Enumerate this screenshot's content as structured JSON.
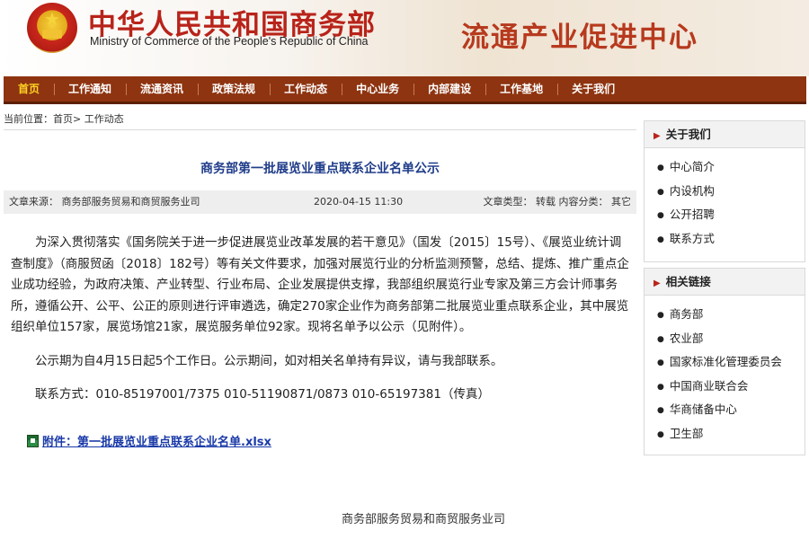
{
  "header": {
    "ministry_cn": "中华人民共和国商务部",
    "ministry_en": "Ministry of Commerce of the People's Republic of China",
    "center_name": "流通产业促进中心",
    "emblem_icon": "national-emblem-icon"
  },
  "nav": {
    "items": [
      {
        "label": "首页"
      },
      {
        "label": "工作通知"
      },
      {
        "label": "流通资讯"
      },
      {
        "label": "政策法规"
      },
      {
        "label": "工作动态"
      },
      {
        "label": "中心业务"
      },
      {
        "label": "内部建设"
      },
      {
        "label": "工作基地"
      },
      {
        "label": "关于我们"
      }
    ],
    "active_index": 0
  },
  "breadcrumb": {
    "prefix": "当前位置：",
    "home": "首页",
    "separator": ">",
    "current": "工作动态"
  },
  "article": {
    "title": "商务部第一批展览业重点联系企业名单公示",
    "source": "文章来源：   商务部服务贸易和商贸服务业司",
    "date": "2020-04-15 11:30",
    "type": "文章类型：  转载  内容分类：  其它",
    "paragraphs": [
      "为深入贯彻落实《国务院关于进一步促进展览业改革发展的若干意见》（国发〔2015〕15号）、《展览业统计调查制度》（商服贸函〔2018〕182号）等有关文件要求，加强对展览行业的分析监测预警，总结、提炼、推广重点企业成功经验，为政府决策、产业转型、行业布局、企业发展提供支撑，我部组织展览行业专家及第三方会计师事务所，遵循公开、公平、公正的原则进行评审遴选，确定270家企业作为商务部第二批展览业重点联系企业，其中展览组织单位157家，展览场馆21家，展览服务单位92家。现将名单予以公示（见附件）。",
      "公示期为自4月15日起5个工作日。公示期间，如对相关名单持有异议，请与我部联系。",
      "联系方式：010-85197001/7375  010-51190871/0873  010-65197381（传真）"
    ],
    "attachment": "附件：第一批展览业重点联系企业名单.xlsx",
    "attachment_icon": "excel-file-icon",
    "footer": "商务部服务贸易和商贸服务业司"
  },
  "sidebar": {
    "about": {
      "title": "关于我们",
      "items": [
        "中心简介",
        "内设机构",
        "公开招聘",
        "联系方式"
      ]
    },
    "links": {
      "title": "相关链接",
      "items": [
        "商务部",
        "农业部",
        "国家标准化管理委员会",
        "中国商业联合会",
        "华商储备中心",
        "卫生部"
      ]
    }
  },
  "colors": {
    "nav_bg": "#8e3410",
    "nav_active": "#ffd323",
    "brand_red": "#b8231a",
    "title_blue": "#1f3c8a",
    "link_blue": "#1a3aa8"
  }
}
